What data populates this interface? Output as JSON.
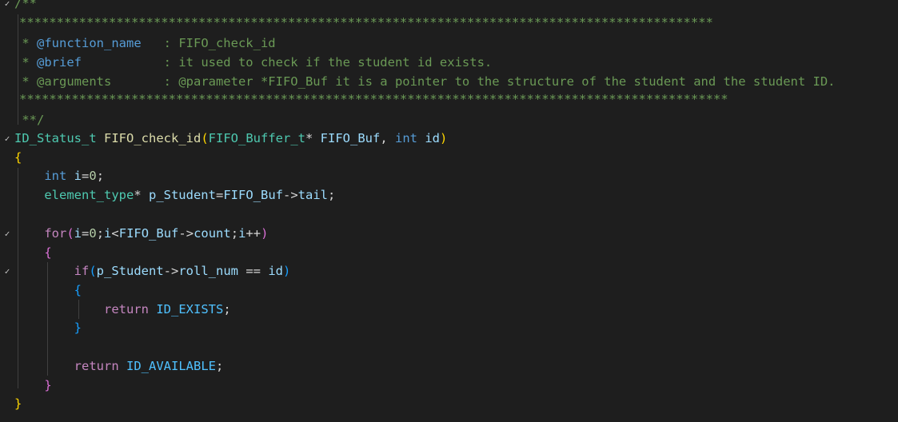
{
  "editor": {
    "colors": {
      "background": "#1e1e1e",
      "comment": "#6a9955",
      "keyword": "#569cd6",
      "type": "#4ec9b0",
      "function": "#dcdcaa",
      "variable": "#9cdcfe",
      "control": "#c586c0",
      "bracket_gold": "#ffd700",
      "bracket_orchid": "#da70d6",
      "bracket_blue": "#179fff"
    },
    "fold_icon": "chevron-down-icon",
    "fold_glyph": "✓",
    "lines": {
      "l1": {
        "open": "/**"
      },
      "l2": {
        "stars": "*********************************************************************************************"
      },
      "l3": {
        "star": " * ",
        "tag": "@function_name",
        "pad": "   ",
        "text": ": FIFO_check_id"
      },
      "l4": {
        "star": " * ",
        "tag": "@brief",
        "pad": "           ",
        "text": ": it used to check if the student id exists."
      },
      "l5": {
        "star": " * ",
        "tag": "@arguments",
        "pad": "       ",
        "text": ": @parameter *FIFO_Buf it is a pointer to the structure of the student and the student ID."
      },
      "l6": {
        "stars": "***********************************************************************************************"
      },
      "l7": {
        "close": " **/"
      },
      "l8": {
        "ret_type": "ID_Status_t",
        "func_name": "FIFO_check_id",
        "lparen": "(",
        "param_type": "FIFO_Buffer_t",
        "ptr": "* ",
        "param1": "FIFO_Buf",
        "comma": ", ",
        "kw_int": "int",
        "param2": "id",
        "rparen": ")"
      },
      "l9": {
        "brace": "{"
      },
      "l10": {
        "indent": "    ",
        "kw_int": "int",
        "rest_var": "i",
        "rest": "=",
        "num": "0",
        "semi": ";"
      },
      "l11": {
        "indent": "    ",
        "type": "element_type",
        "ptr": "* ",
        "var": "p_Student",
        "eq": "=",
        "obj": "FIFO_Buf",
        "arrow": "->",
        "member": "tail",
        "semi": ";"
      },
      "l13": {
        "indent": "    ",
        "kw_for": "for",
        "lparen": "(",
        "v1": "i",
        "eq": "=",
        "num": "0",
        "semi1": ";",
        "v2": "i",
        "lt": "<",
        "obj": "FIFO_Buf",
        "arrow": "->",
        "member": "count",
        "semi2": ";",
        "v3": "i",
        "inc": "++",
        "rparen": ")"
      },
      "l14": {
        "indent": "    ",
        "brace": "{"
      },
      "l15": {
        "indent": "        ",
        "kw_if": "if",
        "lparen": "(",
        "obj": "p_Student",
        "arrow": "->",
        "member": "roll_num",
        "op": " == ",
        "var": "id",
        "rparen": ")"
      },
      "l16": {
        "indent": "        ",
        "brace": "{"
      },
      "l17": {
        "indent": "            ",
        "kw_return": "return",
        "sp": " ",
        "const": "ID_EXISTS",
        "semi": ";"
      },
      "l18": {
        "indent": "        ",
        "brace": "}"
      },
      "l20": {
        "indent": "        ",
        "kw_return": "return",
        "sp": " ",
        "const": "ID_AVAILABLE",
        "semi": ";"
      },
      "l21": {
        "indent": "    ",
        "brace": "}"
      },
      "l22": {
        "brace": "}"
      }
    }
  }
}
